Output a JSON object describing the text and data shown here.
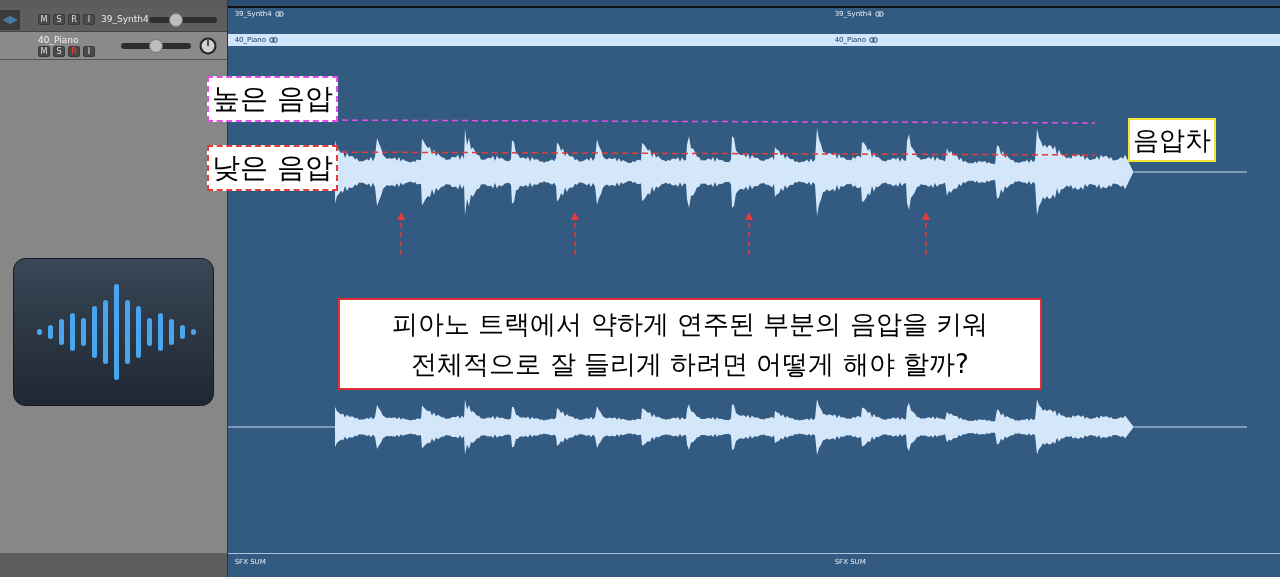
{
  "tracks": [
    {
      "name": "39_Synth4",
      "selected": false,
      "buttons": [
        {
          "label": "M",
          "on": false
        },
        {
          "label": "S",
          "on": false
        },
        {
          "label": "R",
          "on": false
        },
        {
          "label": "I",
          "on": false
        }
      ],
      "level": 0.4
    },
    {
      "name": "40_Piano",
      "selected": true,
      "buttons": [
        {
          "label": "M",
          "on": false
        },
        {
          "label": "S",
          "on": false
        },
        {
          "label": "R",
          "on": true
        },
        {
          "label": "I",
          "on": false
        }
      ],
      "level": 0.5
    }
  ],
  "regions": [
    {
      "labels": [
        "39_Synth4",
        "39_Synth4"
      ],
      "selected": false
    },
    {
      "labels": [
        "40_Piano",
        "40_Piano"
      ],
      "selected": true
    }
  ],
  "bottom_region": {
    "labels": [
      "SFX SUM",
      "SFX SUM"
    ]
  },
  "annotations": {
    "high_label": "높은 음압",
    "low_label": "낮은 음압",
    "difference_label": "음압차",
    "question": [
      "피아노 트랙에서 약하게 연주된 부분의 음압을 키워",
      "전체적으로 잘 들리게 하려면 어떻게 해야 할까?"
    ]
  }
}
